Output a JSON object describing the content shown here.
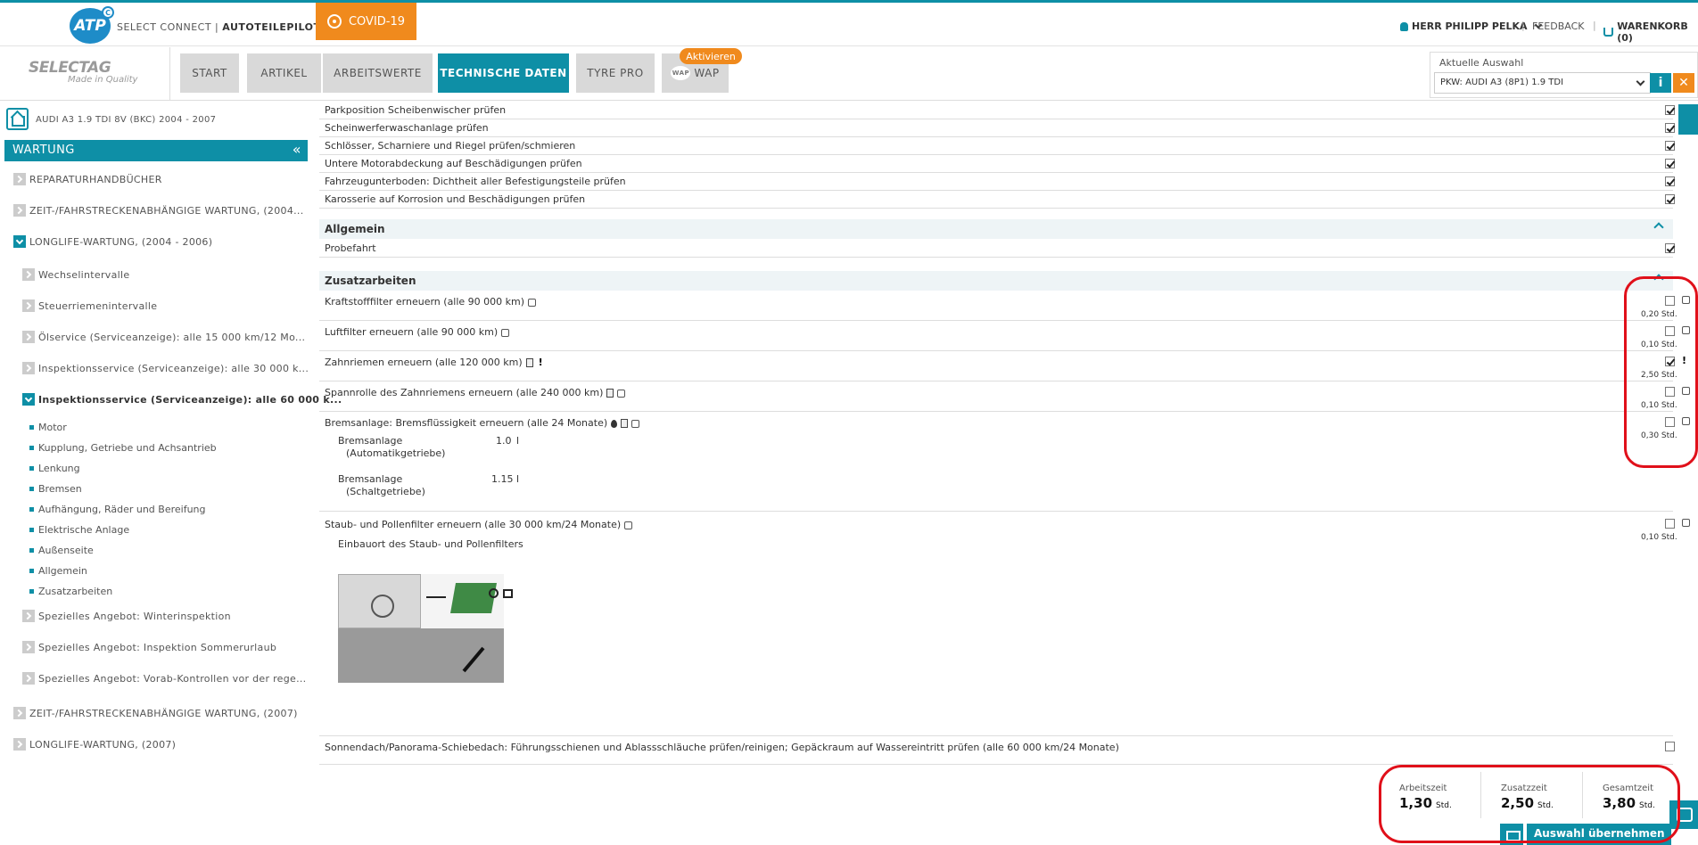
{
  "header": {
    "logo": "ATP",
    "logo_badge": "C",
    "brand_prefix": "SELECT CONNECT |",
    "brand_name": "AUTOTEILEPILOT",
    "covid": "COVID-19",
    "user": "HERR PHILIPP PELKA",
    "separator": "|",
    "feedback": "FEEDBACK",
    "cart": "WARENKORB (0)"
  },
  "nav": {
    "select_logo_main": "SELECTAG",
    "select_logo_sub": "Made in Quality",
    "items": [
      "START",
      "ARTIKEL",
      "ARBEITSWERTE",
      "TECHNISCHE DATEN",
      "TYRE PRO",
      "WAP"
    ],
    "active": "TECHNISCHE DATEN",
    "wap_logo": "WAP",
    "wap_badge": "Aktivieren"
  },
  "selection": {
    "label": "Aktuelle Auswahl",
    "value": "PKW: AUDI A3 (8P1) 1.9 TDI",
    "info": "i",
    "close": "✕"
  },
  "sidebar": {
    "car": "AUDI A3 1.9 TDI 8V (BKC) 2004 - 2007",
    "section": "WARTUNG",
    "collapse": "«",
    "items": [
      "REPARATURHANDBÜCHER",
      "ZEIT-/FAHRSTRECKENABHÄNGIGE WARTUNG, (2004...",
      "LONGLIFE-WARTUNG, (2004 - 2006)",
      "Wechselintervalle",
      "Steuerriemenintervalle",
      "Ölservice (Serviceanzeige): alle 15 000 km/12 Mo...",
      "Inspektionsservice (Serviceanzeige): alle 30 000 k...",
      "Inspektionsservice (Serviceanzeige): alle 60 000 k...",
      "Spezielles Angebot: Winterinspektion",
      "Spezielles Angebot: Inspektion Sommerurlaub",
      "Spezielles Angebot: Vorab-Kontrollen vor der rege...",
      "ZEIT-/FAHRSTRECKENABHÄNGIGE WARTUNG, (2007)",
      "LONGLIFE-WARTUNG, (2007)"
    ],
    "subitems": [
      "Motor",
      "Kupplung, Getriebe und Achsantrieb",
      "Lenkung",
      "Bremsen",
      "Aufhängung, Räder und Bereifung",
      "Elektrische Anlage",
      "Außenseite",
      "Allgemein",
      "Zusatzarbeiten"
    ]
  },
  "checklist": [
    "Parkposition Scheibenwischer prüfen",
    "Scheinwerferwaschanlage prüfen",
    "Schlösser, Scharniere und Riegel prüfen/schmieren",
    "Untere Motorabdeckung auf Beschädigungen prüfen",
    "Fahrzeugunterboden: Dichtheit aller Befestigungsteile prüfen",
    "Karosserie auf Korrosion und Beschädigungen prüfen"
  ],
  "allgemein": {
    "title": "Allgemein",
    "items": [
      "Probefahrt"
    ]
  },
  "zusatz": {
    "title": "Zusatzarbeiten",
    "items": [
      {
        "label": "Kraftstofffilter erneuern (alle 90 000 km)",
        "time": "0,20 Std.",
        "checked": false
      },
      {
        "label": "Luftfilter erneuern (alle 90 000 km)",
        "time": "0,10 Std.",
        "checked": false
      },
      {
        "label": "Zahnriemen erneuern (alle 120 000 km)",
        "time": "2,50 Std.",
        "checked": true
      },
      {
        "label": "Spannrolle des Zahnriemens erneuern (alle 240 000 km)",
        "time": "0,10 Std.",
        "checked": false
      },
      {
        "label": "Bremsanlage: Bremsflüssigkeit erneuern (alle 24 Monate)",
        "time": "0,30 Std.",
        "checked": false
      },
      {
        "label": "Staub- und Pollenfilter erneuern (alle 30 000 km/24 Monate)",
        "time": "0,10 Std.",
        "checked": false
      },
      {
        "label": "Sonnendach/Panorama-Schiebedach: Führungsschienen und Ablassschläuche prüfen/reinigen; Gepäckraum auf Wassereintritt prüfen (alle 60 000 km/24 Monate)",
        "time": "",
        "checked": false
      }
    ],
    "brake_fluid": [
      {
        "name": "Bremsanlage",
        "detail": "(Automatikgetriebe)",
        "value": "1.0",
        "unit": "l"
      },
      {
        "name": "Bremsanlage",
        "detail": "(Schaltgetriebe)",
        "value": "1.15",
        "unit": "l"
      }
    ],
    "pollen_caption": "Einbauort des Staub- und Pollenfilters"
  },
  "totals": {
    "arbeitszeit_label": "Arbeitszeit",
    "arbeitszeit": "1,30",
    "zusatzzeit_label": "Zusatzzeit",
    "zusatzzeit": "2,50",
    "gesamtzeit_label": "Gesamtzeit",
    "gesamtzeit": "3,80",
    "unit": "Std."
  },
  "buttons": {
    "take_over": "Auswahl übernehmen"
  },
  "colors": {
    "accent": "#0e8fa6",
    "orange": "#f08a1d",
    "annotation": "#e0101a"
  }
}
